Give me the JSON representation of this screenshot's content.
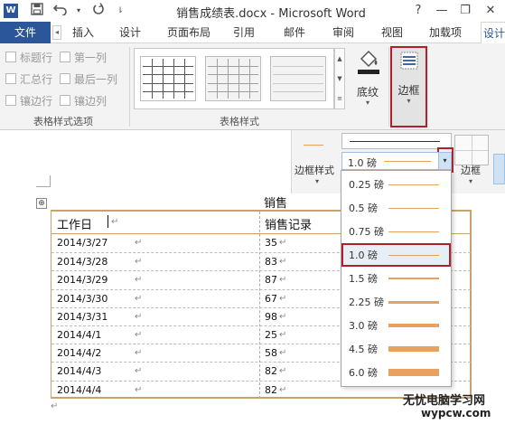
{
  "window": {
    "app_icon": "W",
    "title": "销售成绩表.docx - Microsoft Word",
    "help": "?",
    "minimize": "—",
    "restore": "❐",
    "close": "✕"
  },
  "quick_access": {
    "save_icon": "save-icon",
    "undo_icon": "undo-icon",
    "redo_icon": "redo-icon",
    "customize_icon": "customize-icon"
  },
  "tabs": [
    "文件",
    "插入",
    "设计",
    "页面布局",
    "引用",
    "邮件",
    "审阅",
    "视图",
    "加载项",
    "设计"
  ],
  "ribbon": {
    "options_checkboxes": [
      "标题行",
      "第一列",
      "汇总行",
      "最后一列",
      "镶边行",
      "镶边列"
    ],
    "options_group_label": "表格样式选项",
    "styles_group_label": "表格样式",
    "shading_label": "底纹",
    "borders_label": "边框"
  },
  "border_toolbar": {
    "border_styles_label": "边框样式",
    "selected_weight": "1.0 磅",
    "borders_label": "边框"
  },
  "weights_dropdown": {
    "items": [
      "0.25 磅",
      "0.5 磅",
      "0.75 磅",
      "1.0 磅",
      "1.5 磅",
      "2.25 磅",
      "3.0 磅",
      "4.5 磅",
      "6.0 磅"
    ],
    "line_widths": [
      0.25,
      0.5,
      0.75,
      1.0,
      1.5,
      2.25,
      3.0,
      4.5,
      6.0
    ],
    "selected_index": 3,
    "line_color": "#e8a15f"
  },
  "document": {
    "title_partial": "销售",
    "table_move_handle": "⊕",
    "header": [
      "工作日",
      "销售记录"
    ],
    "rows": [
      [
        "2014/3/27",
        "35"
      ],
      [
        "2014/3/28",
        "83"
      ],
      [
        "2014/3/29",
        "87"
      ],
      [
        "2014/3/30",
        "67"
      ],
      [
        "2014/3/31",
        "98"
      ],
      [
        "2014/4/1",
        "25"
      ],
      [
        "2014/4/2",
        "58"
      ],
      [
        "2014/4/3",
        "82"
      ],
      [
        "2014/4/4",
        "82"
      ]
    ],
    "para_mark": "↵"
  },
  "watermark": {
    "line1": "无忧电脑学习网",
    "line2": "wypcw.com"
  },
  "colors": {
    "accent": "#2b579a",
    "highlight_border": "#b01f2b",
    "table_border": "#c8a26b"
  }
}
